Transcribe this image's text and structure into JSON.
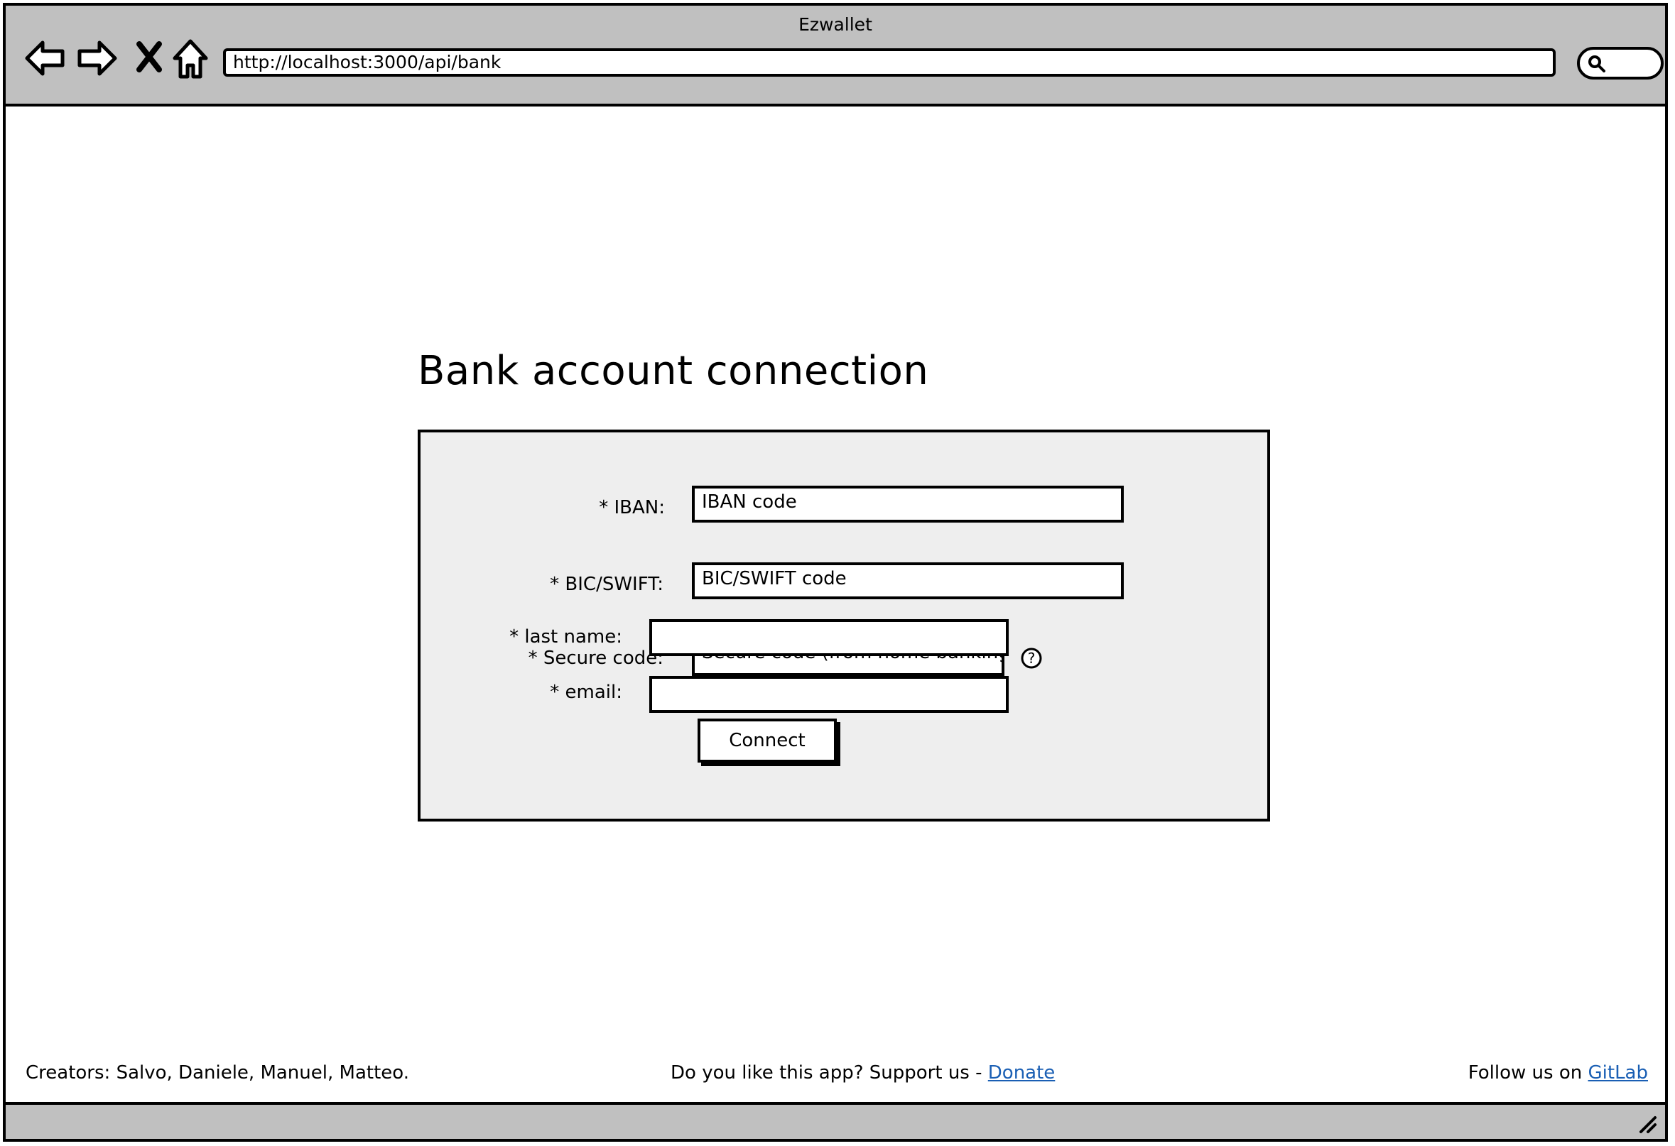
{
  "browser": {
    "title": "Ezwallet",
    "url": "http://localhost:3000/api/bank"
  },
  "page": {
    "heading": "Bank account connection"
  },
  "form": {
    "iban_label": "* IBAN:",
    "iban_value": "IBAN code",
    "bic_label": "* BIC/SWIFT:",
    "bic_value": "BIC/SWIFT code",
    "lastname_label": "* last name:",
    "lastname_value": "",
    "secure_label": "* Secure code:",
    "secure_value": "Secure code (from home banking)",
    "email_label": "* email:",
    "email_value": "",
    "connect_label": "Connect"
  },
  "footer": {
    "creators": "Creators: Salvo, Daniele, Manuel, Matteo.",
    "support_text": "Do you like this app? Support us - ",
    "donate_link": "Donate",
    "follow_text": "Follow us on ",
    "gitlab_link": "GitLab"
  },
  "icons": {
    "back": "arrow-left-icon",
    "forward": "arrow-right-icon",
    "stop": "close-icon",
    "home": "home-icon",
    "search": "search-icon",
    "help": "help-icon",
    "resize": "resize-grip-icon"
  },
  "colors": {
    "chrome": "#c0c0c0",
    "panel": "#eeeeee",
    "link": "#1a5fb4"
  }
}
